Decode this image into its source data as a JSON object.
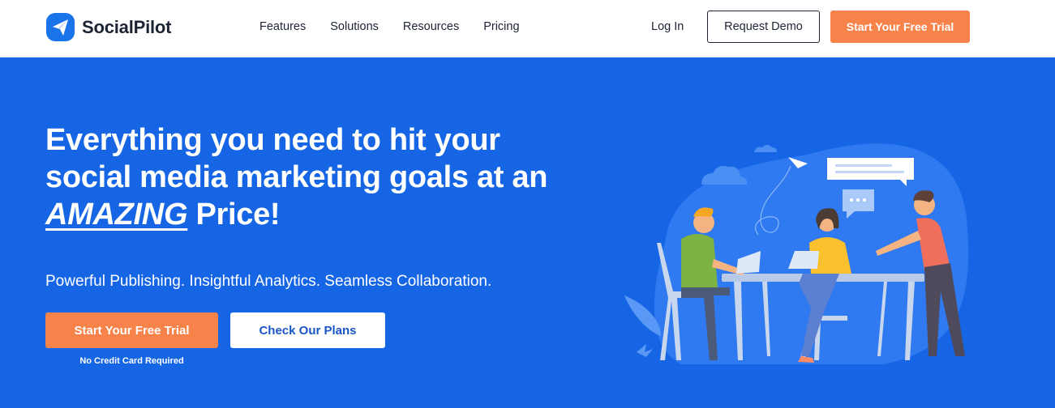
{
  "brand": {
    "name": "SocialPilot",
    "logo_icon": "paper-plane-icon",
    "accent": "#1565e5",
    "cta": "#f7834a"
  },
  "nav": {
    "items": [
      {
        "label": "Features"
      },
      {
        "label": "Solutions"
      },
      {
        "label": "Resources"
      },
      {
        "label": "Pricing"
      }
    ],
    "login_label": "Log In",
    "demo_label": "Request Demo",
    "trial_label": "Start Your Free Trial"
  },
  "hero": {
    "title_line1": "Everything you need to hit your",
    "title_line2": "social media marketing goals at an",
    "title_emph": "AMAZING",
    "title_end": " Price!",
    "subtitle": "Powerful Publishing. Insightful Analytics. Seamless Collaboration.",
    "cta_primary": "Start Your Free Trial",
    "cta_secondary": "Check Our Plans",
    "note": "No Credit Card Required"
  }
}
